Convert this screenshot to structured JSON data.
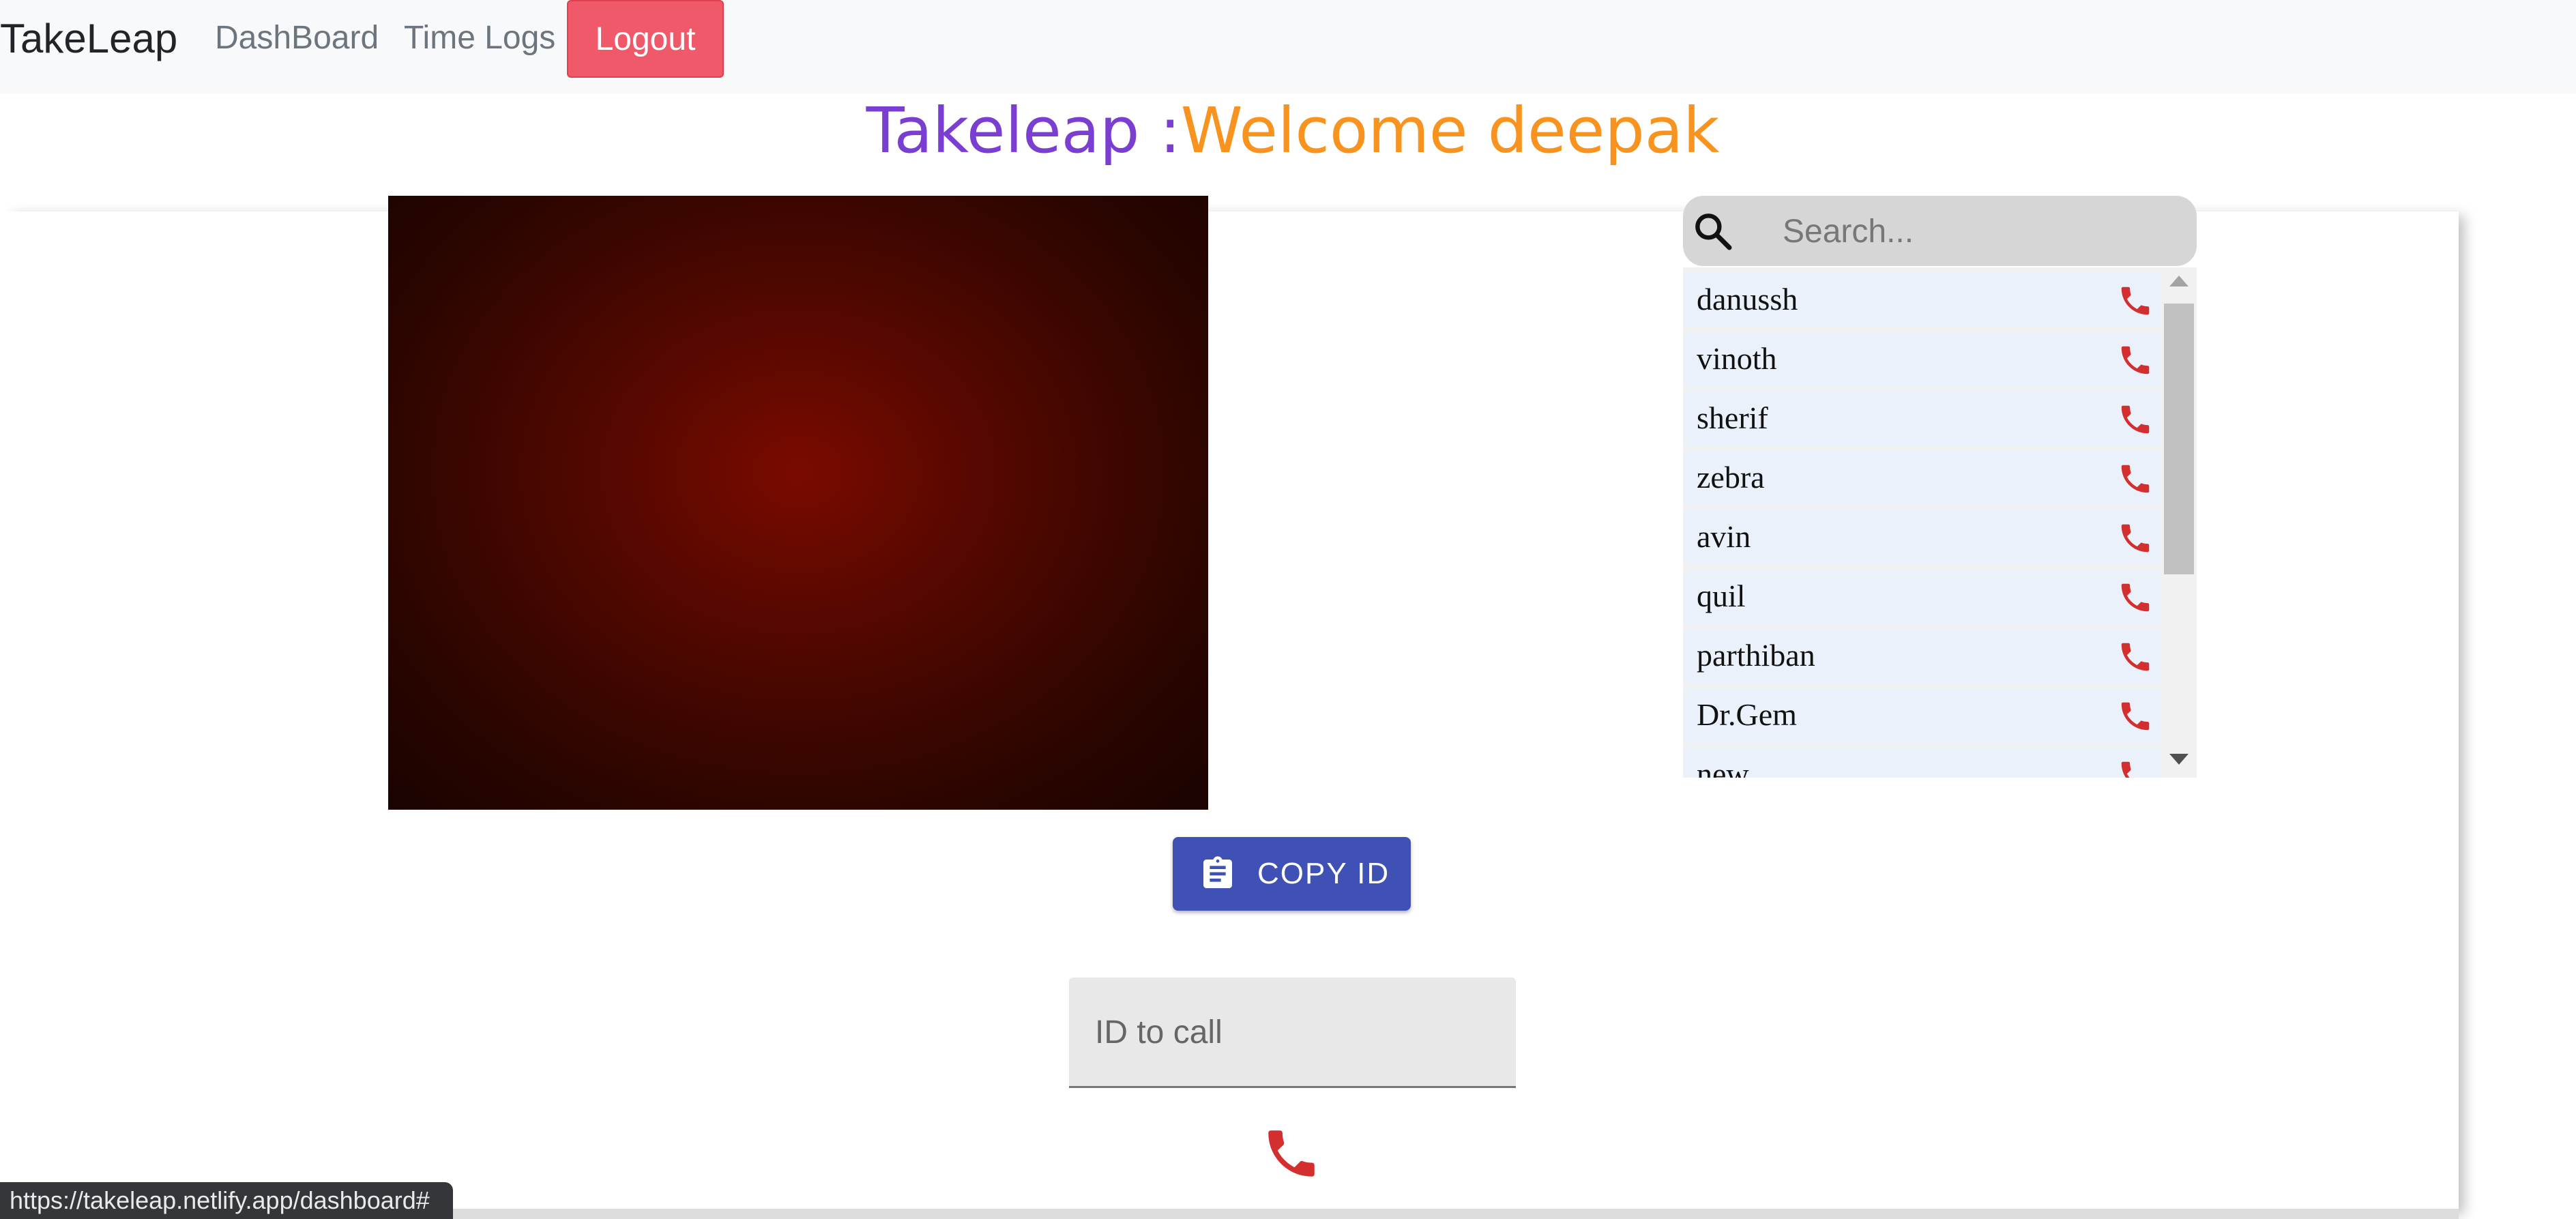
{
  "navbar": {
    "brand": "TakeLeap",
    "links": [
      "DashBoard",
      "Time Logs"
    ],
    "logout_label": "Logout"
  },
  "heading": {
    "prefix": "Takeleap :",
    "welcome": "Welcome deepak"
  },
  "search": {
    "placeholder": "Search..."
  },
  "users": [
    "danussh",
    "vinoth",
    "sherif",
    "zebra",
    "avin",
    "quil",
    "parthiban",
    "Dr.Gem",
    "new"
  ],
  "copy_button": {
    "label": "COPY ID"
  },
  "id_field": {
    "placeholder": "ID to call"
  },
  "status_bar": {
    "url": "https://takeleap.netlify.app/dashboard#"
  },
  "colors": {
    "brand_purple": "#7a3fd1",
    "welcome_orange": "#f7931e",
    "logout_red": "#f0596a",
    "copy_blue": "#3f51b5",
    "call_red": "#d32f2f"
  },
  "icons": {
    "search": "search-icon",
    "call": "phone-icon",
    "clipboard": "clipboard-icon"
  }
}
